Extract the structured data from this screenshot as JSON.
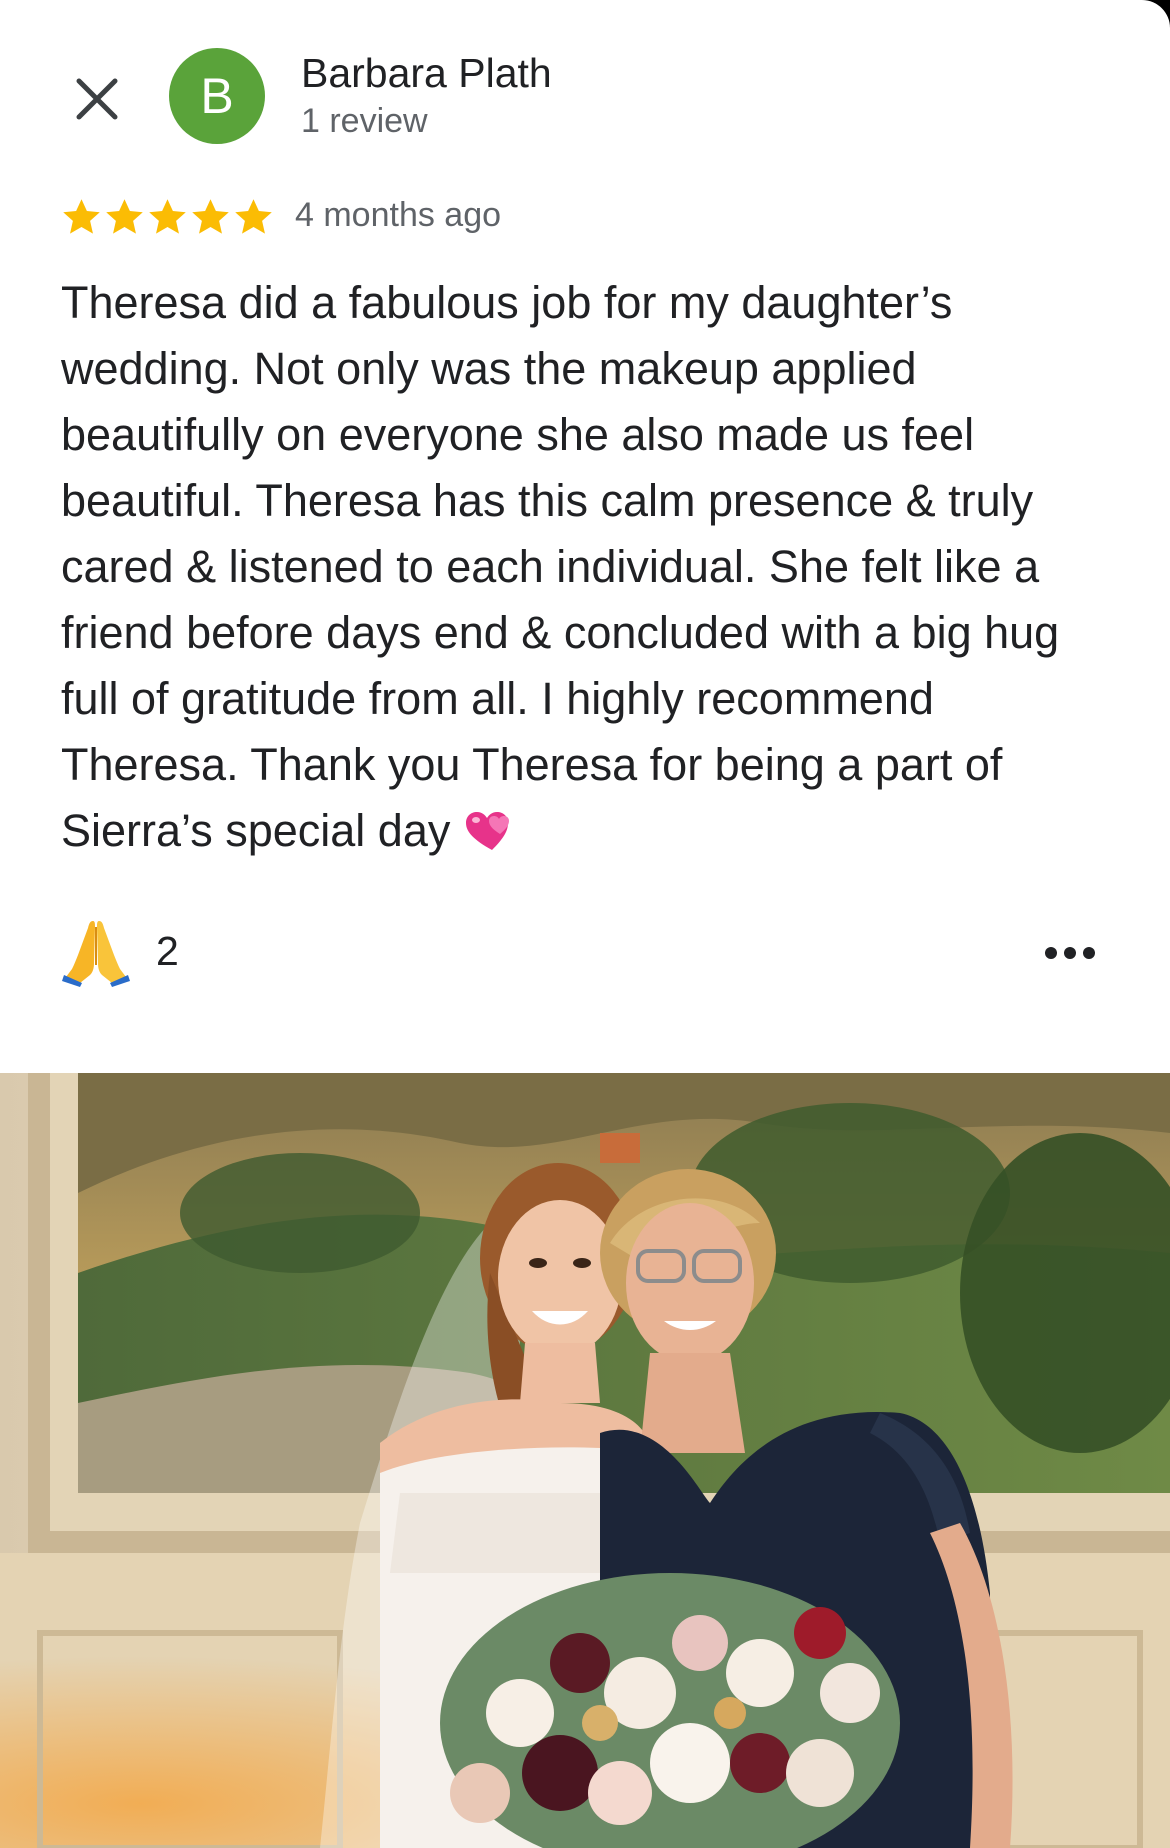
{
  "reviewer": {
    "avatar_letter": "B",
    "name": "Barbara Plath",
    "review_count": "1 review"
  },
  "review": {
    "rating": 5,
    "rating_max": 5,
    "time": "4 months ago",
    "text": "Theresa did a fabulous job for my daughter’s wedding. Not only was the makeup applied beautifully on everyone she also made us feel beautiful. Theresa has this calm presence & truly cared & listened to each individual. She felt like a friend before days end & concluded with a big hug full of gratitude from all. I highly recommend Theresa. Thank you Theresa for being a part of Sierra’s special day"
  },
  "reactions": {
    "icon": "folded-hands-icon",
    "count": "2"
  },
  "icons": {
    "close": "close-icon",
    "star": "star-icon",
    "heart": "revolving-hearts-icon",
    "more": "more-horiz-icon"
  },
  "colors": {
    "avatar_bg": "#5aa33a",
    "star": "#fbbc04",
    "secondary_text": "#5f6368",
    "primary_text": "#202124"
  },
  "photo": {
    "icon": "review-photo"
  }
}
